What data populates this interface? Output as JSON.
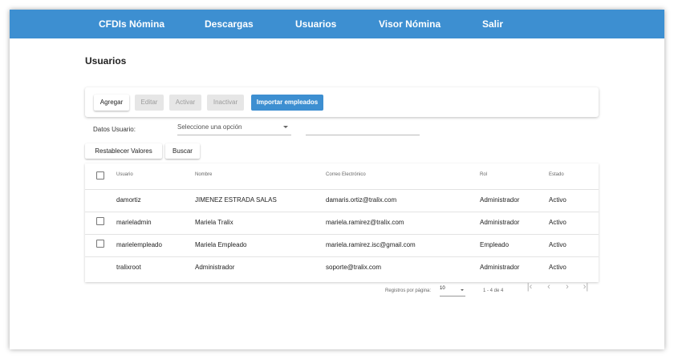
{
  "nav": {
    "items": [
      {
        "label": "CFDIs Nómina"
      },
      {
        "label": "Descargas"
      },
      {
        "label": "Usuarios"
      },
      {
        "label": "Visor Nómina"
      },
      {
        "label": "Salir"
      }
    ]
  },
  "page": {
    "title": "Usuarios"
  },
  "toolbar": {
    "add": "Agregar",
    "edit": "Editar",
    "activate": "Activar",
    "deactivate": "Inactivar",
    "import": "Importar empleados"
  },
  "filter": {
    "label": "Datos Usuario:",
    "select_placeholder": "Seleccione una opción",
    "search_value": ""
  },
  "actions": {
    "reset": "Restablecer Valores",
    "search": "Buscar"
  },
  "table": {
    "headers": {
      "user": "Usuario",
      "name": "Nombre",
      "email": "Correo Electrónico",
      "role": "Rol",
      "status": "Estado"
    },
    "rows": [
      {
        "user": "damortiz",
        "name": "JIMENEZ ESTRADA SALAS",
        "email": "damaris.ortiz@tralix.com",
        "role": "Administrador",
        "status": "Activo"
      },
      {
        "user": "marieladmin",
        "name": "Mariela Tralix",
        "email": "mariela.ramirez@tralix.com",
        "role": "Administrador",
        "status": "Activo"
      },
      {
        "user": "marielempleado",
        "name": "Mariela Empleado",
        "email": "mariela.ramirez.isc@gmail.com",
        "role": "Empleado",
        "status": "Activo"
      },
      {
        "user": "tralixroot",
        "name": "Administrador",
        "email": "soporte@tralix.com",
        "role": "Administrador",
        "status": "Activo"
      }
    ]
  },
  "pager": {
    "rows_per_page_label": "Registros por página:",
    "rows_per_page": "10",
    "range": "1 - 4 de 4"
  },
  "colors": {
    "accent": "#3d8fd1"
  }
}
